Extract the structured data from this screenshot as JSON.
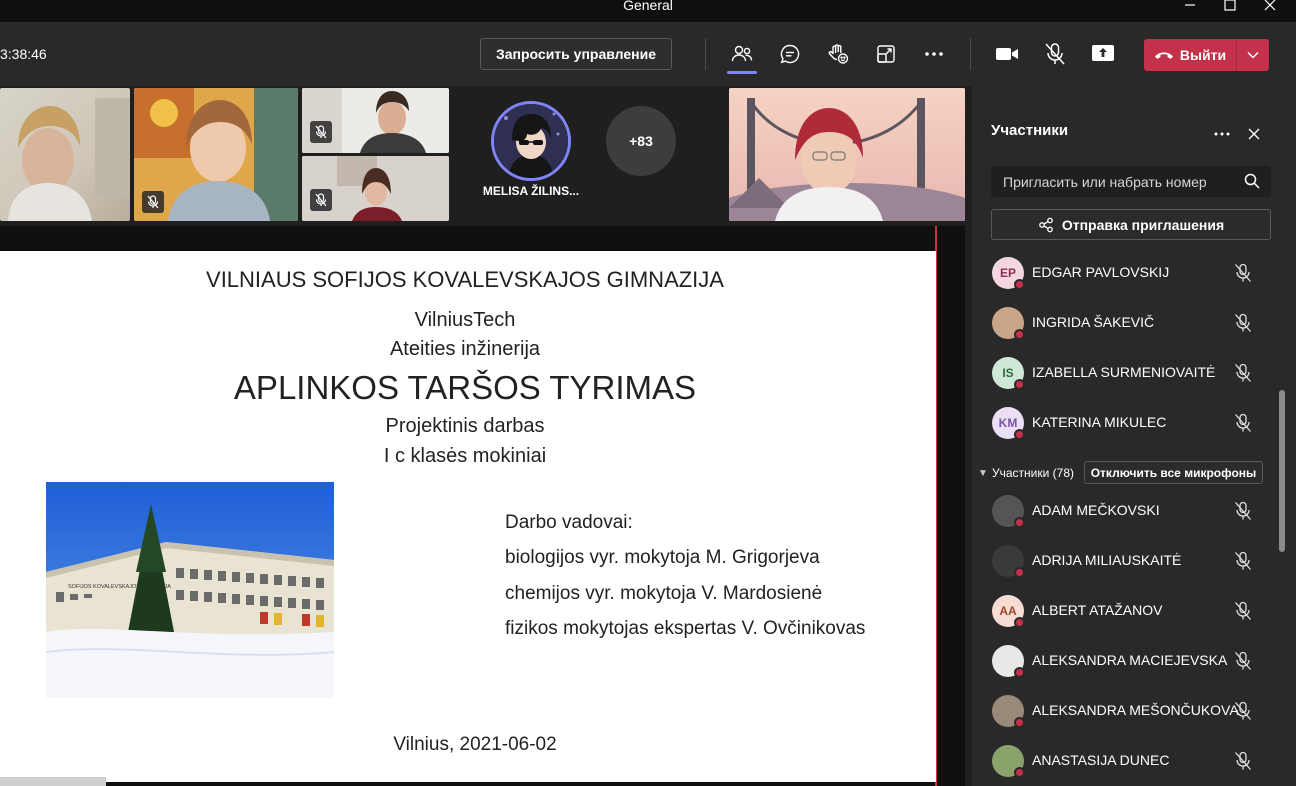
{
  "window": {
    "title": "General"
  },
  "toolbar": {
    "timer": "3:38:46",
    "request_control": "Запросить управление",
    "leave": "Выйти"
  },
  "video": {
    "spotlight_name": "MELISA ŽILINS...",
    "more_count": "+83"
  },
  "slide": {
    "school": "VILNIAUS SOFIJOS KOVALEVSKAJOS GIMNAZIJA",
    "partner": "VilniusTech",
    "program": "Ateities inžinerija",
    "title": "APLINKOS TARŠOS TYRIMAS",
    "subtitle": "Projektinis darbas",
    "class": "I c klasės mokiniai",
    "supervisors_label": "Darbo vadovai:",
    "supervisors": [
      "biologijos vyr. mokytoja M. Grigorjeva",
      "chemijos vyr. mokytoja V. Mardosienė",
      "fizikos mokytojas ekspertas V. Ovčinikovas"
    ],
    "building_sign": "SOFIJOS KOVALEVSKAJOS GIMNAZIJA",
    "footer": "Vilnius, 2021-06-02"
  },
  "panel": {
    "title": "Участники",
    "invite_placeholder": "Пригласить или набрать номер",
    "send_invite": "Отправка приглашения",
    "section_label": "Участники (78)",
    "mute_all": "Отключить все микрофоны",
    "top_participants": [
      {
        "initials": "EP",
        "name": "EDGAR PAVLOVSKIJ",
        "avatar_color": "#f3d6e0",
        "initials_color": "#8a2f54"
      },
      {
        "initials": "",
        "name": "INGRIDA ŠAKEVIČ",
        "avatar_color": "#c9a58a",
        "initials_color": "#ffffff"
      },
      {
        "initials": "IS",
        "name": "IZABELLA SURMENIOVAITĖ",
        "avatar_color": "#cfe8d6",
        "initials_color": "#2f6b45"
      },
      {
        "initials": "KM",
        "name": "KATERINA MIKULEC",
        "avatar_color": "#eadff5",
        "initials_color": "#7a54a8"
      }
    ],
    "participants": [
      {
        "initials": "",
        "name": "ADAM MEČKOVSKI",
        "avatar_color": "#555555",
        "initials_color": "#ffffff"
      },
      {
        "initials": "",
        "name": "ADRIJA MILIAUSKAITĖ",
        "avatar_color": "#3a3a3a",
        "initials_color": "#ffffff"
      },
      {
        "initials": "AA",
        "name": "ALBERT ATAŽANOV",
        "avatar_color": "#f6dcd2",
        "initials_color": "#a0452a"
      },
      {
        "initials": "",
        "name": "ALEKSANDRA MACIEJEVSKA",
        "avatar_color": "#e8e8e8",
        "initials_color": "#333333"
      },
      {
        "initials": "",
        "name": "ALEKSANDRA MEŠONČUKOVA",
        "avatar_color": "#9a8878",
        "initials_color": "#ffffff"
      },
      {
        "initials": "",
        "name": "ANASTASIJA DUNEC",
        "avatar_color": "#8aa36a",
        "initials_color": "#ffffff"
      }
    ]
  },
  "colors": {
    "accent": "#7f85f5",
    "leave": "#c4314b",
    "panel_bg": "#292929",
    "toolbar_bg": "#292929"
  }
}
